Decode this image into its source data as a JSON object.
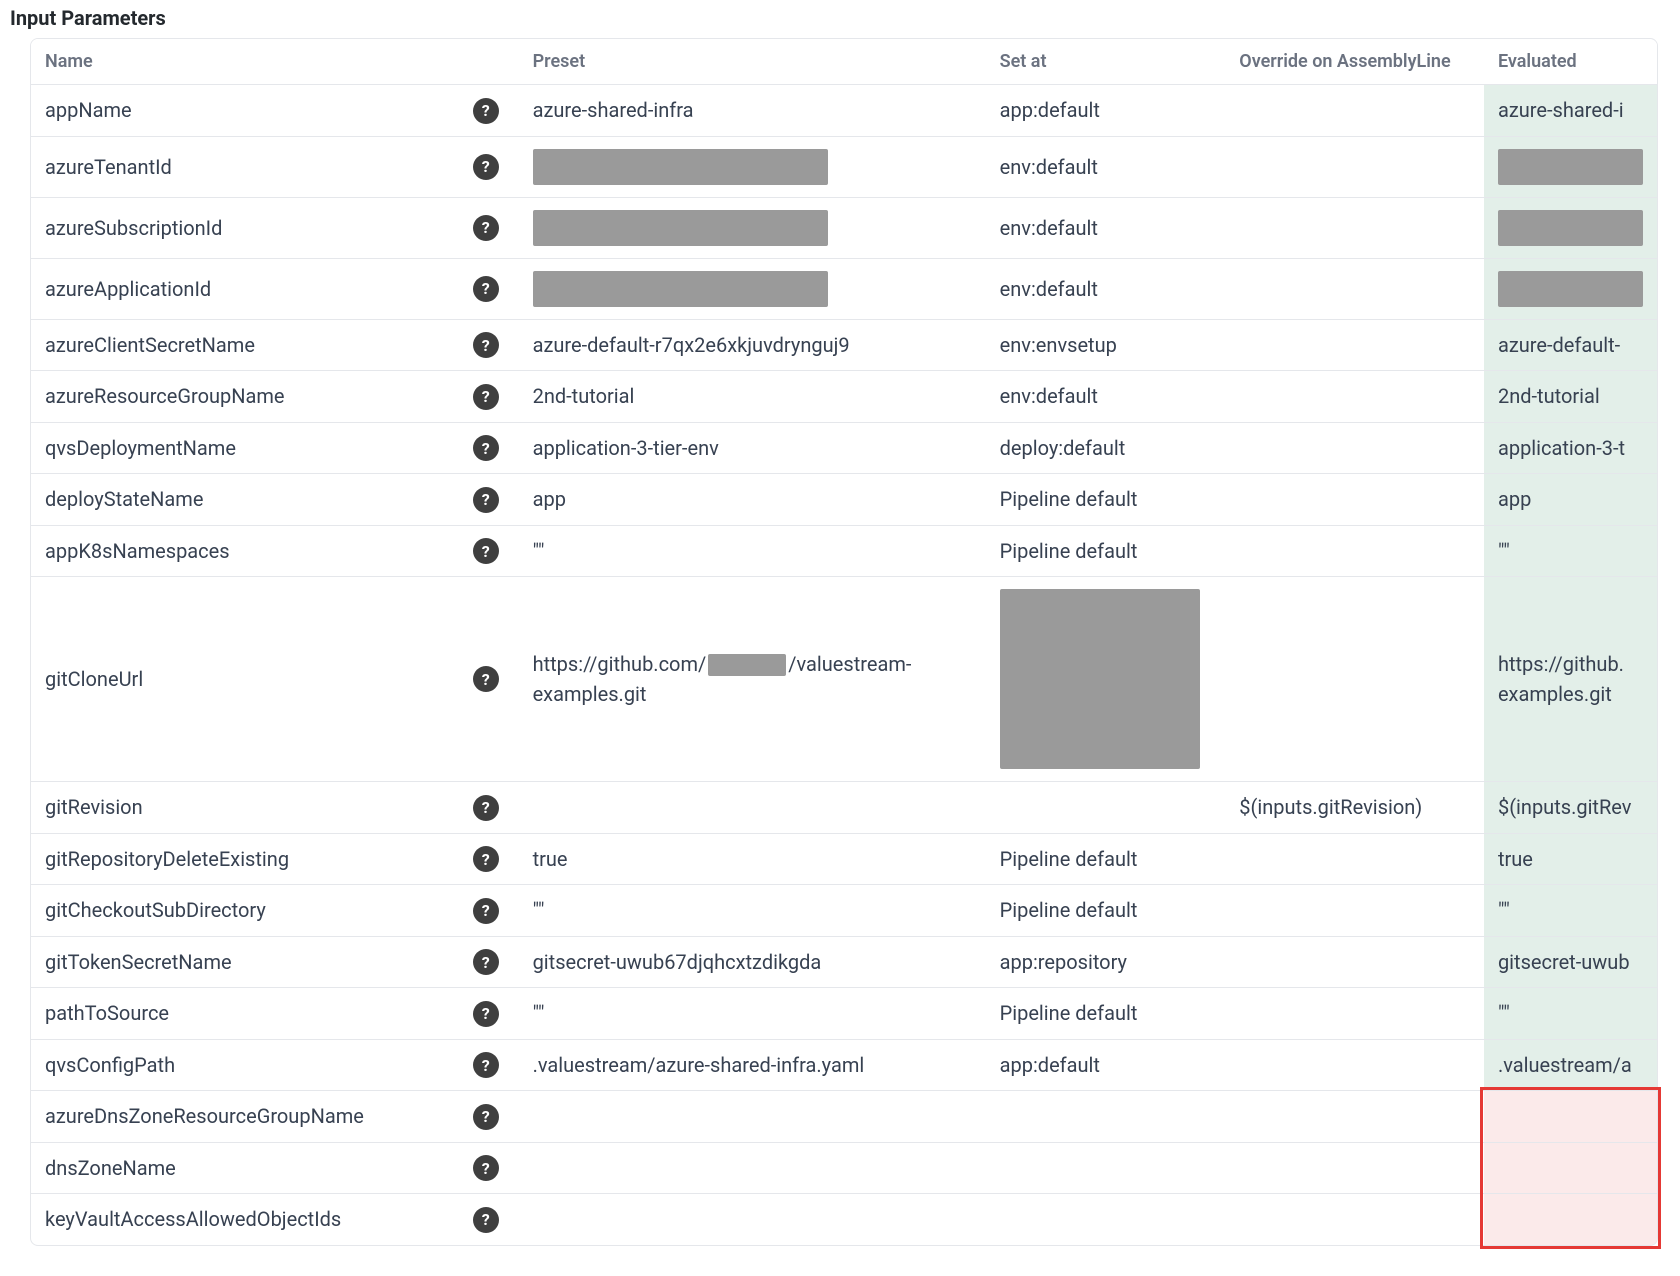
{
  "title": "Input Parameters",
  "columns": {
    "name": "Name",
    "preset": "Preset",
    "setat": "Set at",
    "override": "Override on AssemblyLine",
    "evaluated": "Evaluated"
  },
  "rows": [
    {
      "name": "appName",
      "preset": "azure-shared-infra",
      "setat": "app:default",
      "override": "",
      "evaluated": "azure-shared-i",
      "presetRedacted": false,
      "setatRedacted": false,
      "evalRedacted": false,
      "evalMissing": false
    },
    {
      "name": "azureTenantId",
      "preset": "",
      "setat": "env:default",
      "override": "",
      "evaluated": "",
      "presetRedacted": true,
      "setatRedacted": false,
      "evalRedacted": true,
      "evalMissing": false
    },
    {
      "name": "azureSubscriptionId",
      "preset": "",
      "setat": "env:default",
      "override": "",
      "evaluated": "",
      "presetRedacted": true,
      "setatRedacted": false,
      "evalRedacted": true,
      "evalMissing": false
    },
    {
      "name": "azureApplicationId",
      "preset": "",
      "setat": "env:default",
      "override": "",
      "evaluated": "",
      "presetRedacted": true,
      "setatRedacted": false,
      "evalRedacted": true,
      "evalMissing": false
    },
    {
      "name": "azureClientSecretName",
      "preset": "azure-default-r7qx2e6xkjuvdrynguj9",
      "setat": "env:envsetup",
      "override": "",
      "evaluated": "azure-default-",
      "presetRedacted": false,
      "setatRedacted": false,
      "evalRedacted": false,
      "evalMissing": false
    },
    {
      "name": "azureResourceGroupName",
      "preset": "2nd-tutorial",
      "setat": "env:default",
      "override": "",
      "evaluated": "2nd-tutorial",
      "presetRedacted": false,
      "setatRedacted": false,
      "evalRedacted": false,
      "evalMissing": false
    },
    {
      "name": "qvsDeploymentName",
      "preset": "application-3-tier-env",
      "setat": "deploy:default",
      "override": "",
      "evaluated": "application-3-t",
      "presetRedacted": false,
      "setatRedacted": false,
      "evalRedacted": false,
      "evalMissing": false
    },
    {
      "name": "deployStateName",
      "preset": "app",
      "setat": "Pipeline default",
      "override": "",
      "evaluated": "app",
      "presetRedacted": false,
      "setatRedacted": false,
      "evalRedacted": false,
      "evalMissing": false
    },
    {
      "name": "appK8sNamespaces",
      "preset": "\"\"",
      "setat": "Pipeline default",
      "override": "",
      "evaluated": "\"\"",
      "presetRedacted": false,
      "setatRedacted": false,
      "evalRedacted": false,
      "evalMissing": false
    },
    {
      "name": "gitCloneUrl",
      "presetPrefix": "https://github.com/",
      "presetSuffix": "/valuestream-examples.git",
      "setat": "",
      "override": "",
      "evaluatedPrefix": "https://github.",
      "evaluatedSuffix": "examples.git",
      "presetRedacted": false,
      "presetInlineRedact": true,
      "setatRedacted": true,
      "setatBigRedact": true,
      "evalRedacted": false,
      "evalMissing": false,
      "tall": true
    },
    {
      "name": "gitRevision",
      "preset": "",
      "setat": "",
      "override": "$(inputs.gitRevision)",
      "evaluated": "$(inputs.gitRev",
      "presetRedacted": false,
      "setatRedacted": false,
      "evalRedacted": false,
      "evalMissing": false
    },
    {
      "name": "gitRepositoryDeleteExisting",
      "preset": "true",
      "setat": "Pipeline default",
      "override": "",
      "evaluated": "true",
      "presetRedacted": false,
      "setatRedacted": false,
      "evalRedacted": false,
      "evalMissing": false
    },
    {
      "name": "gitCheckoutSubDirectory",
      "preset": "\"\"",
      "setat": "Pipeline default",
      "override": "",
      "evaluated": "\"\"",
      "presetRedacted": false,
      "setatRedacted": false,
      "evalRedacted": false,
      "evalMissing": false
    },
    {
      "name": "gitTokenSecretName",
      "preset": "gitsecret-uwub67djqhcxtzdikgda",
      "setat": "app:repository",
      "override": "",
      "evaluated": "gitsecret-uwub",
      "presetRedacted": false,
      "setatRedacted": false,
      "evalRedacted": false,
      "evalMissing": false
    },
    {
      "name": "pathToSource",
      "preset": "\"\"",
      "setat": "Pipeline default",
      "override": "",
      "evaluated": "\"\"",
      "presetRedacted": false,
      "setatRedacted": false,
      "evalRedacted": false,
      "evalMissing": false
    },
    {
      "name": "qvsConfigPath",
      "preset": ".valuestream/azure-shared-infra.yaml",
      "setat": "app:default",
      "override": "",
      "evaluated": ".valuestream/a",
      "presetRedacted": false,
      "setatRedacted": false,
      "evalRedacted": false,
      "evalMissing": false
    },
    {
      "name": "azureDnsZoneResourceGroupName",
      "preset": "",
      "setat": "",
      "override": "",
      "evaluated": "",
      "presetRedacted": false,
      "setatRedacted": false,
      "evalRedacted": false,
      "evalMissing": true
    },
    {
      "name": "dnsZoneName",
      "preset": "",
      "setat": "",
      "override": "",
      "evaluated": "",
      "presetRedacted": false,
      "setatRedacted": false,
      "evalRedacted": false,
      "evalMissing": true
    },
    {
      "name": "keyVaultAccessAllowedObjectIds",
      "preset": "",
      "setat": "",
      "override": "",
      "evaluated": "",
      "presetRedacted": false,
      "setatRedacted": false,
      "evalRedacted": false,
      "evalMissing": true
    }
  ]
}
